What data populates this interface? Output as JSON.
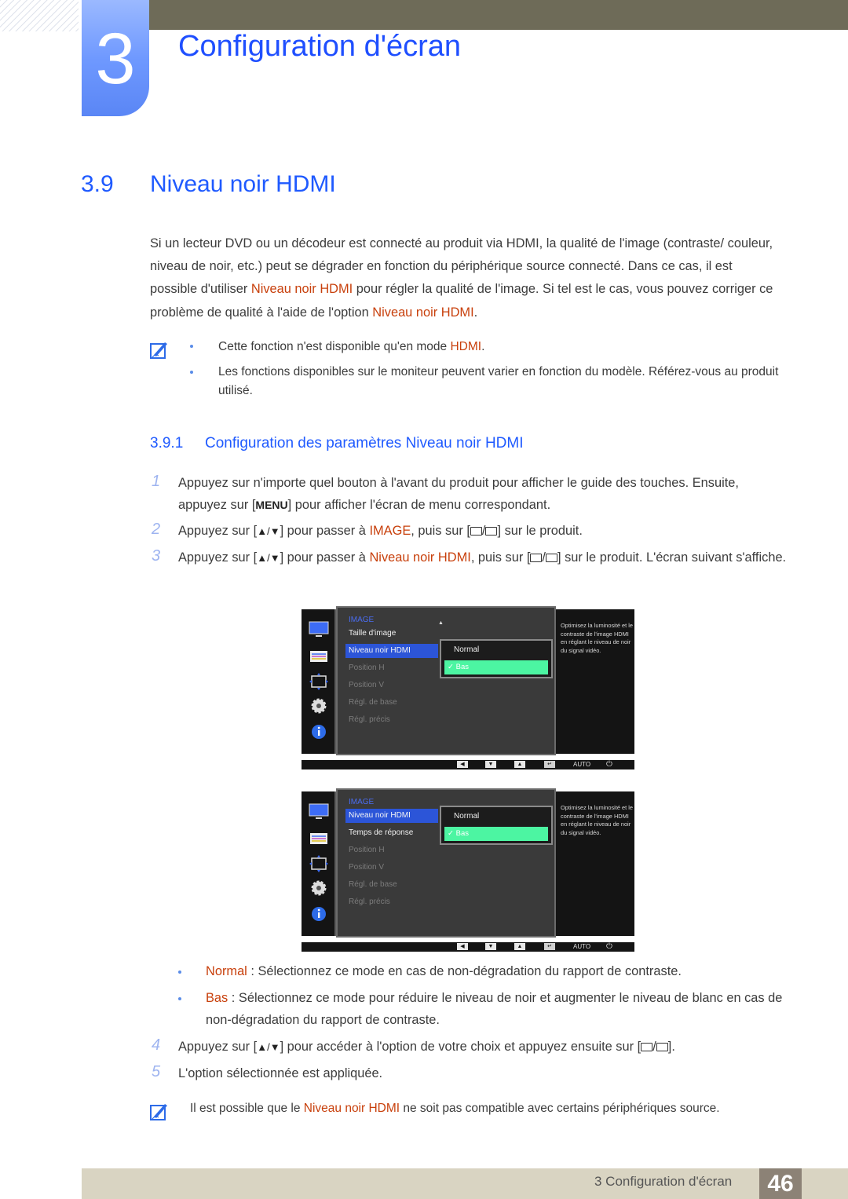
{
  "header": {
    "chapter_number": "3",
    "chapter_title": "Configuration d'écran"
  },
  "section": {
    "number": "3.9",
    "title": "Niveau noir HDMI"
  },
  "intro": {
    "p1": "Si un lecteur DVD ou un décodeur est connecté au produit via HDMI, la qualité de l'image (contraste/ couleur, niveau de noir, etc.) peut se dégrader en fonction du périphérique source connecté. Dans ce cas, il est possible d'utiliser ",
    "h1": "Niveau noir HDMI",
    "p2": " pour régler la qualité de l'image. Si tel est le cas, vous pouvez corriger ce problème de qualité à l'aide de l'option ",
    "h2": "Niveau noir HDMI",
    "p3": "."
  },
  "notes": {
    "n1_text": "Cette fonction n'est disponible qu'en mode ",
    "n1_hl": "HDMI",
    "n1_end": ".",
    "n2_text": "Les fonctions disponibles sur le moniteur peuvent varier en fonction du modèle. Référez-vous au produit utilisé."
  },
  "subsection": {
    "number": "3.9.1",
    "title": "Configuration des paramètres Niveau noir HDMI"
  },
  "steps": {
    "s1_num": "1",
    "s1_a": "Appuyez sur n'importe quel bouton à l'avant du produit pour afficher le guide des touches. Ensuite, appuyez sur [",
    "s1_key": "MENU",
    "s1_b": "] pour afficher l'écran de menu correspondant.",
    "s2_num": "2",
    "s2_a": "Appuyez sur [",
    "s2_b": "] pour passer à ",
    "s2_hl": "IMAGE",
    "s2_c": ", puis sur [",
    "s2_d": "] sur le produit.",
    "s3_num": "3",
    "s3_a": "Appuyez sur [",
    "s3_b": "] pour passer à ",
    "s3_hl": "Niveau noir HDMI",
    "s3_c": ", puis sur [",
    "s3_d": "] sur le produit. L'écran suivant s'affiche.",
    "s4_num": "4",
    "s4_a": "Appuyez sur [",
    "s4_b": "] pour accéder à l'option de votre choix et appuyez ensuite sur [",
    "s4_c": "].",
    "s5_num": "5",
    "s5_text": "L'option sélectionnée est appliquée.",
    "updown": "▲/▼",
    "slash": "/"
  },
  "osd1": {
    "header": "IMAGE",
    "items": [
      "Taille d'image",
      "Niveau noir HDMI",
      "Position H",
      "Position V",
      "Régl. de base",
      "Régl. précis"
    ],
    "selected": "Niveau noir HDMI",
    "options": [
      "Normal",
      "Bas"
    ],
    "checked_option": "Bas",
    "description": "Optimisez la luminosité et le contraste de l'image HDMI en réglant le niveau de noir du signal vidéo.",
    "bar_auto": "AUTO"
  },
  "osd2": {
    "header": "IMAGE",
    "items": [
      "Niveau noir HDMI",
      "Temps de réponse",
      "Position H",
      "Position V",
      "Régl. de base",
      "Régl. précis"
    ],
    "selected": "Niveau noir HDMI",
    "options": [
      "Normal",
      "Bas"
    ],
    "checked_option": "Bas",
    "description": "Optimisez la luminosité et le contraste de l'image HDMI en réglant le niveau de noir du signal vidéo.",
    "bar_auto": "AUTO"
  },
  "options_desc": {
    "normal_label": "Normal",
    "normal_text": " : Sélectionnez ce mode en cas de non-dégradation du rapport de contraste.",
    "bas_label": "Bas",
    "bas_text": " : Sélectionnez ce mode pour réduire le niveau de noir et augmenter le niveau de blanc en cas de non-dégradation du rapport de contraste."
  },
  "final_note": {
    "a": "Il est possible que le ",
    "hl": "Niveau noir HDMI",
    "b": " ne soit pas compatible avec certains périphériques source."
  },
  "footer": {
    "chapter_label": "3 Configuration d'écran",
    "page_number": "46"
  },
  "colors": {
    "accent_blue": "#1f5aff",
    "highlight_orange": "#c8400c",
    "osd_selected": "#2c55d8",
    "osd_option_checked": "#4cf5a2"
  }
}
